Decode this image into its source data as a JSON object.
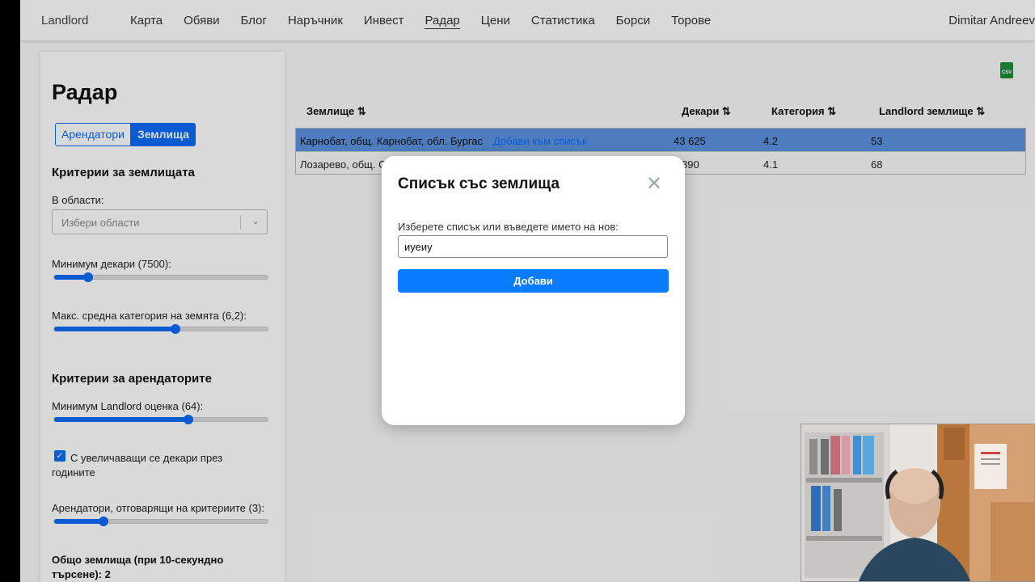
{
  "nav": {
    "brand": "Landlord",
    "links": [
      "Карта",
      "Обяви",
      "Блог",
      "Наръчник",
      "Инвест",
      "Радар",
      "Цени",
      "Статистика",
      "Борси",
      "Торове"
    ],
    "active": "Радар",
    "user": "Dimitar Andreev"
  },
  "sidebar": {
    "title": "Радар",
    "tabs": [
      "Арендатори",
      "Землища"
    ],
    "active_tab": "Землища",
    "criteria_land_title": "Критерии за землищата",
    "regions_label": "В области:",
    "regions_placeholder": "Избери области",
    "min_decares_label": "Минимум декари (7500):",
    "min_decares_level": 0.16,
    "max_category_label": "Макс. средна категория на земята (6,2):",
    "max_category_level": 0.57,
    "criteria_tenants_title": "Критерии за арендаторите",
    "min_score_label": "Минимум Landlord оценка (64):",
    "min_score_level": 0.63,
    "increasing_label": "С увеличаващи се декари през годините",
    "matching_label": "Арендатори, отговарящи на критериите (3):",
    "matching_level": 0.23,
    "total_label": "Общо землища (при 10-секундно търсене): 2"
  },
  "table": {
    "headers": [
      "Землище ⇅",
      "Декари ⇅",
      "Категория ⇅",
      "Landlord землище ⇅"
    ],
    "rows": [
      {
        "name": "Карнобат, общ. Карнобат, обл. Бургас",
        "action": "Добави към списък",
        "decares": "43 625",
        "category": "4.2",
        "landlord": "53"
      },
      {
        "name": "Лозарево, общ. С",
        "action": "",
        "decares": "890",
        "category": "4.1",
        "landlord": "68"
      }
    ]
  },
  "csv_icon_label": "CSV",
  "modal": {
    "title": "Списък със землища",
    "input_label": "Изберете списък или въведете името на нов:",
    "input_value": "иуеиу",
    "submit_label": "Добави"
  }
}
